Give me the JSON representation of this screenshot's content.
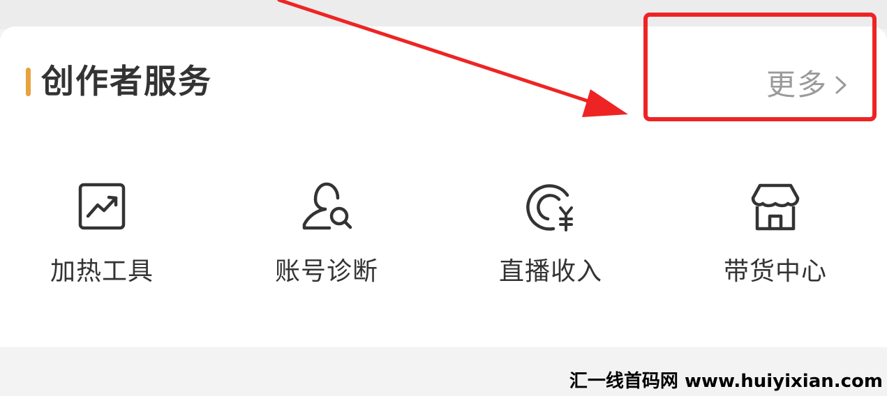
{
  "section": {
    "title": "创作者服务",
    "more_label": "更多",
    "accent_color": "#e8a23e"
  },
  "services": [
    {
      "label": "加热工具",
      "icon": "trending-chart-icon"
    },
    {
      "label": "账号诊断",
      "icon": "user-search-icon"
    },
    {
      "label": "直播收入",
      "icon": "live-income-yuan-icon"
    },
    {
      "label": "带货中心",
      "icon": "storefront-icon"
    }
  ],
  "annotation": {
    "box_color": "#ee2424",
    "arrow_color": "#ee2424"
  },
  "watermark": {
    "text": "汇一线首码网 www.huiyixian.com"
  }
}
